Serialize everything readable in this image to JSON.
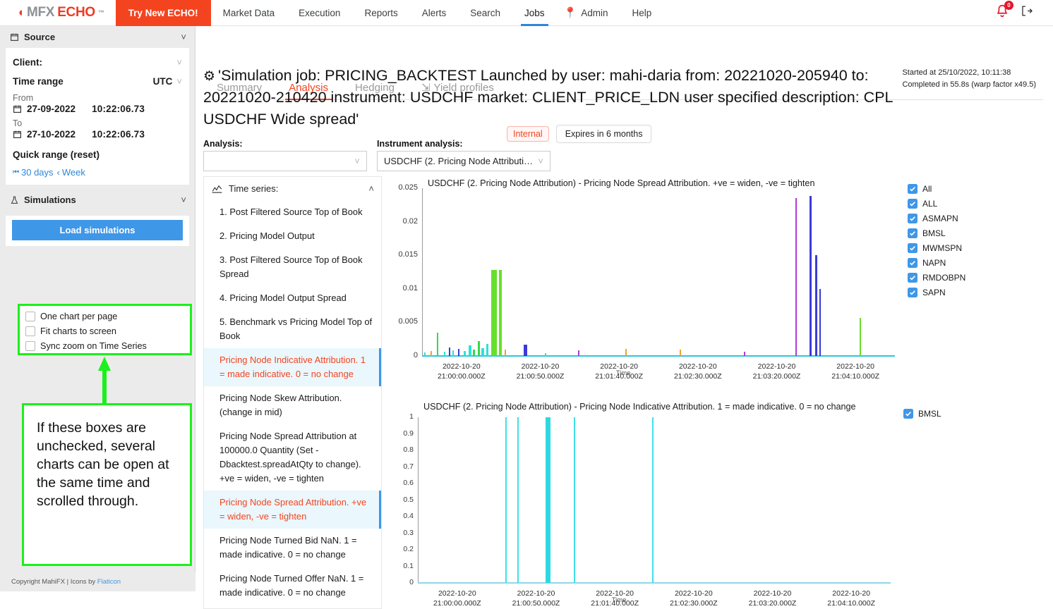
{
  "brand": {
    "swirl_icon": "swirl-icon",
    "mfx": "MFX",
    "echo": "ECHO",
    "tm": "™"
  },
  "header": {
    "try_button": "Try New ECHO!",
    "nav": [
      {
        "label": "Market Data",
        "active": false
      },
      {
        "label": "Execution",
        "active": false
      },
      {
        "label": "Reports",
        "active": false
      },
      {
        "label": "Alerts",
        "active": false
      },
      {
        "label": "Search",
        "active": false
      },
      {
        "label": "Jobs",
        "active": true
      },
      {
        "label": "Admin",
        "active": false,
        "icon": "pin-icon"
      },
      {
        "label": "Help",
        "active": false
      }
    ],
    "bell_icon": "bell-icon",
    "bell_badge": "0",
    "logout_icon": "logout-icon",
    "accent": "#f4441f",
    "active_underline": "#2f86d6"
  },
  "sidebar": {
    "source": {
      "icon": "calendar-icon",
      "title": "Source",
      "collapse_icon": "chevron-down-icon",
      "client_label": "Client:",
      "client_value": "",
      "time_range_label": "Time range",
      "timezone": "UTC",
      "from_label": "From",
      "from_date": "27-09-2022",
      "from_time": "10:22:06.73",
      "to_label": "To",
      "to_date": "27-10-2022",
      "to_time": "10:22:06.73",
      "quick_range_label": "Quick range (reset)",
      "quick_buttons": [
        {
          "icon": "skip-back-icon",
          "label": "30 days"
        },
        {
          "icon": "chevron-left-icon",
          "label": "Week"
        }
      ]
    },
    "simulations": {
      "icon": "flask-icon",
      "title": "Simulations",
      "collapse_icon": "chevron-down-icon",
      "load_button": "Load simulations",
      "checkboxes": [
        {
          "label": "One chart per page",
          "checked": false
        },
        {
          "label": "Fit charts to screen",
          "checked": false
        },
        {
          "label": "Sync zoom on Time Series",
          "checked": false
        }
      ]
    },
    "footer_text": "Copyright MahiFX | Icons by ",
    "footer_link": "Flaticon"
  },
  "annotation": {
    "highlight_color": "#1cf01c",
    "text": "If these boxes are unchecked, several charts can be open at the same time and scrolled through."
  },
  "main": {
    "job_title": "'Simulation job: PRICING_BACKTEST Launched by user: mahi-daria from: 20221020-205940 to: 20221020-210420 instrument: USDCHF market: CLIENT_PRICE_LDN user specified description: CPL USDCHF Wide spread'",
    "job_title_icon": "flask-icon",
    "internal_badge": "Internal",
    "expires_badge": "Expires in 6 months",
    "started_at": "Started at 25/10/2022, 10:11:38",
    "completed_in": "Completed in 55.8s (warp factor x49.5)",
    "tabs": [
      {
        "label": "Summary",
        "active": false
      },
      {
        "label": "Analysis",
        "active": true
      },
      {
        "label": "Hedging",
        "active": false
      },
      {
        "label": "Yield profiles",
        "active": false,
        "icon": "export-icon"
      }
    ],
    "analysis_label": "Analysis:",
    "analysis_value": "",
    "instrument_label": "Instrument analysis:",
    "instrument_value": "USDCHF (2. Pricing Node Attributi…",
    "dropdown_icon": "chevron-down-icon",
    "time_series": {
      "icon": "line-chart-icon",
      "title": "Time series:",
      "collapse_icon": "chevron-up-icon",
      "items": [
        {
          "label": "1. Post Filtered Source Top of Book",
          "selected": false
        },
        {
          "label": "2. Pricing Model Output",
          "selected": false
        },
        {
          "label": "3. Post Filtered Source Top of Book Spread",
          "selected": false
        },
        {
          "label": "4. Pricing Model Output Spread",
          "selected": false
        },
        {
          "label": "5. Benchmark vs Pricing Model Top of Book",
          "selected": false
        },
        {
          "label": "Pricing Node Indicative Attribution. 1 = made indicative. 0 = no change",
          "selected": true
        },
        {
          "label": "Pricing Node Skew Attribution. (change in mid)",
          "selected": false
        },
        {
          "label": "Pricing Node Spread Attribution at 100000.0 Quantity (Set -Dbacktest.spreadAtQty to change). +ve = widen, -ve = tighten",
          "selected": false
        },
        {
          "label": "Pricing Node Spread Attribution. +ve = widen, -ve = tighten",
          "selected": true
        },
        {
          "label": "Pricing Node Turned Bid NaN. 1 = made indicative. 0 = no change",
          "selected": false
        },
        {
          "label": "Pricing Node Turned Offer NaN. 1 = made indicative. 0 = no change",
          "selected": false
        }
      ]
    }
  },
  "chart_data": [
    {
      "type": "line",
      "title": "USDCHF (2. Pricing Node Attribution) - Pricing Node Spread Attribution. +ve = widen, -ve = tighten",
      "xlabel": "Time",
      "ylabel": "",
      "ylim": [
        0,
        0.025
      ],
      "yticks": [
        0,
        0.005,
        0.01,
        0.015,
        0.02,
        0.025
      ],
      "ytick_labels": [
        "0",
        "0.005",
        "0.01",
        "0.015",
        "0.02",
        "0.025"
      ],
      "xtick_labels": [
        "2022-10-20\n21:00:00.000Z",
        "2022-10-20\n21:00:50.000Z",
        "2022-10-20\n21:01:40.000Z",
        "2022-10-20\n21:02:30.000Z",
        "2022-10-20\n21:03:20.000Z",
        "2022-10-20\n21:04:10.000Z"
      ],
      "grid": false,
      "legend_position": "right",
      "legend": [
        {
          "label": "All",
          "checked": true,
          "color": "#3f97e8"
        },
        {
          "label": "ALL",
          "checked": true,
          "color": "#3f97e8"
        },
        {
          "label": "ASMAPN",
          "checked": true,
          "color": "#3f97e8"
        },
        {
          "label": "BMSL",
          "checked": true,
          "color": "#3f97e8"
        },
        {
          "label": "MWMSPN",
          "checked": true,
          "color": "#3f97e8"
        },
        {
          "label": "NAPN",
          "checked": true,
          "color": "#3f97e8"
        },
        {
          "label": "RMDOBPN",
          "checked": true,
          "color": "#3f97e8"
        },
        {
          "label": "SAPN",
          "checked": true,
          "color": "#3f97e8"
        }
      ],
      "spikes": [
        {
          "x": 0.5,
          "y": 0.0005,
          "color": "#2fe0d8",
          "w": 2
        },
        {
          "x": 1.8,
          "y": 0.0007,
          "color": "#f0a32a",
          "w": 2
        },
        {
          "x": 3.2,
          "y": 0.0035,
          "color": "#35d94a",
          "w": 2
        },
        {
          "x": 4.6,
          "y": 0.0006,
          "color": "#2fe0d8",
          "w": 2
        },
        {
          "x": 5.6,
          "y": 0.0013,
          "color": "#3b3bd6",
          "w": 2
        },
        {
          "x": 6.4,
          "y": 0.0008,
          "color": "#2fe0d8",
          "w": 2
        },
        {
          "x": 7.6,
          "y": 0.0011,
          "color": "#3b3bd6",
          "w": 2
        },
        {
          "x": 8.8,
          "y": 0.0007,
          "color": "#2fe0d8",
          "w": 3
        },
        {
          "x": 9.8,
          "y": 0.0016,
          "color": "#2fe0d8",
          "w": 4
        },
        {
          "x": 10.8,
          "y": 0.0009,
          "color": "#35d94a",
          "w": 3
        },
        {
          "x": 11.8,
          "y": 0.0022,
          "color": "#35d94a",
          "w": 3
        },
        {
          "x": 12.6,
          "y": 0.0012,
          "color": "#2fe0d8",
          "w": 4
        },
        {
          "x": 13.6,
          "y": 0.0018,
          "color": "#2fe0d8",
          "w": 3
        },
        {
          "x": 14.6,
          "y": 0.0128,
          "color": "#66e02a",
          "w": 8
        },
        {
          "x": 16.2,
          "y": 0.0128,
          "color": "#66e02a",
          "w": 4
        },
        {
          "x": 17.4,
          "y": 0.0009,
          "color": "#f0a32a",
          "w": 2
        },
        {
          "x": 21.5,
          "y": 0.0017,
          "color": "#3b3bd6",
          "w": 5
        },
        {
          "x": 26.0,
          "y": 0.0004,
          "color": "#2fe0d8",
          "w": 2
        },
        {
          "x": 33.0,
          "y": 0.0008,
          "color": "#b13bd6",
          "w": 2
        },
        {
          "x": 43.0,
          "y": 0.0011,
          "color": "#f0a32a",
          "w": 2
        },
        {
          "x": 54.5,
          "y": 0.0009,
          "color": "#f0a32a",
          "w": 2
        },
        {
          "x": 68.0,
          "y": 0.0006,
          "color": "#b13bd6",
          "w": 2
        },
        {
          "x": 79.0,
          "y": 0.0235,
          "color": "#b13bd6",
          "w": 2
        },
        {
          "x": 82.0,
          "y": 0.0238,
          "color": "#3b3bd6",
          "w": 3
        },
        {
          "x": 83.2,
          "y": 0.015,
          "color": "#3b3bd6",
          "w": 3
        },
        {
          "x": 84.0,
          "y": 0.01,
          "color": "#3b3bd6",
          "w": 2
        },
        {
          "x": 92.5,
          "y": 0.0057,
          "color": "#66e02a",
          "w": 2
        }
      ],
      "baseline_color": "#2fc6d8"
    },
    {
      "type": "line",
      "title": "USDCHF (2. Pricing Node Attribution) - Pricing Node Indicative Attribution. 1 = made indicative. 0 = no change",
      "xlabel": "Time",
      "ylabel": "",
      "ylim": [
        0,
        1
      ],
      "yticks": [
        0,
        0.1,
        0.2,
        0.3,
        0.4,
        0.5,
        0.6,
        0.7,
        0.8,
        0.9,
        1
      ],
      "ytick_labels": [
        "0",
        "0.1",
        "0.2",
        "0.3",
        "0.4",
        "0.5",
        "0.6",
        "0.7",
        "0.8",
        "0.9",
        "1"
      ],
      "xtick_labels": [
        "2022-10-20\n21:00:00.000Z",
        "2022-10-20\n21:00:50.000Z",
        "2022-10-20\n21:01:40.000Z",
        "2022-10-20\n21:02:30.000Z",
        "2022-10-20\n21:03:20.000Z",
        "2022-10-20\n21:04:10.000Z"
      ],
      "grid": false,
      "legend_position": "right",
      "legend": [
        {
          "label": "BMSL",
          "checked": true,
          "color": "#3f97e8"
        }
      ],
      "spikes": [
        {
          "x": 18.5,
          "y": 1,
          "color": "#3fe0e8",
          "w": 2
        },
        {
          "x": 21.0,
          "y": 1,
          "color": "#3fe0e8",
          "w": 2
        },
        {
          "x": 27.0,
          "y": 1,
          "color": "#2fd8e0",
          "w": 7
        },
        {
          "x": 33.0,
          "y": 1,
          "color": "#3fe0e8",
          "w": 2
        },
        {
          "x": 49.5,
          "y": 1,
          "color": "#3fe0e8",
          "w": 2
        }
      ],
      "baseline_color": "#8fd8e8"
    }
  ]
}
